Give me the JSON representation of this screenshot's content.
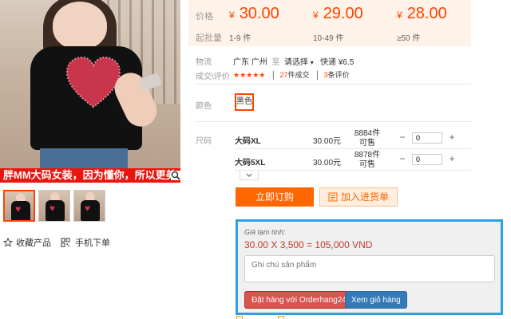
{
  "product_image": {
    "banner_text": "胖MM大码女装，因为懂你，所以更美"
  },
  "actions": {
    "favorite_label": "收藏产品",
    "mobile_label": "手机下单"
  },
  "price_panel": {
    "price_label": "价格",
    "batch_label": "起批量",
    "currency": "¥",
    "tiers": [
      {
        "price": "30.00",
        "qty": "1-9 件"
      },
      {
        "price": "29.00",
        "qty": "10-49 件"
      },
      {
        "price": "28.00",
        "qty": "≥50 件"
      }
    ]
  },
  "logistics": {
    "label": "物流",
    "origin": "广东 广州",
    "to": "至",
    "select": "请选择",
    "express": "快递 ¥6.5"
  },
  "reviews": {
    "label": "成交\\评价",
    "stars": "★★★★★",
    "sold_count": "27",
    "sold_suffix": "件成交",
    "review_count": "3",
    "review_suffix": "条评价"
  },
  "color": {
    "label": "颜色",
    "selected": "黑色"
  },
  "size": {
    "label": "尺码",
    "rows": [
      {
        "name": "大码XL",
        "price": "30.00元",
        "stock": "8884件可售",
        "qty": "0"
      },
      {
        "name": "大码5XL",
        "price": "30.00元",
        "stock": "8878件可售",
        "qty": "0"
      }
    ]
  },
  "buttons": {
    "order": "立即订购",
    "add_cart": "加入进货单"
  },
  "estimate": {
    "label": "Giá tạm tính:",
    "sum": "30.00 X 3,500 = 105,000 VND",
    "note_placeholder": "Ghi chú sản phẩm",
    "order_btn": "Đặt hàng với Orderhang24h",
    "cart_btn": "Xem giỏ hàng"
  },
  "colors": {
    "accent": "#ff4400",
    "estimate_border": "#2ea0e2",
    "btn_red": "#d9534f",
    "btn_blue": "#337ab7"
  }
}
